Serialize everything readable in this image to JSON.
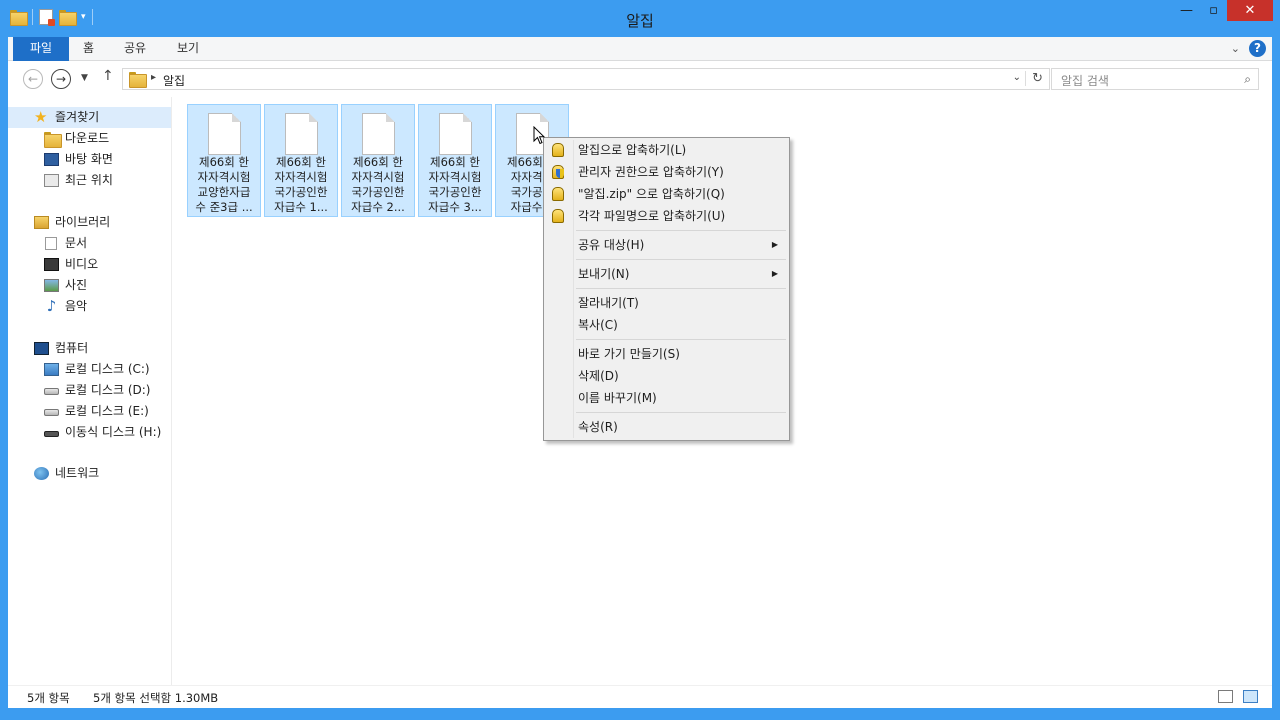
{
  "window": {
    "title": "알집"
  },
  "ribbon": {
    "tabs": [
      "파일",
      "홈",
      "공유",
      "보기"
    ]
  },
  "address": {
    "crumb": "알집"
  },
  "search": {
    "placeholder": "알집 검색"
  },
  "sidebar": {
    "items": [
      {
        "label": "즐겨찾기",
        "icon": "star-icon"
      },
      {
        "label": "다운로드",
        "icon": "download-folder-icon"
      },
      {
        "label": "바탕 화면",
        "icon": "desktop-icon"
      },
      {
        "label": "최근 위치",
        "icon": "recent-places-icon"
      },
      {
        "label": "라이브러리",
        "icon": "library-icon"
      },
      {
        "label": "문서",
        "icon": "documents-icon"
      },
      {
        "label": "비디오",
        "icon": "videos-icon"
      },
      {
        "label": "사진",
        "icon": "pictures-icon"
      },
      {
        "label": "음악",
        "icon": "music-icon"
      },
      {
        "label": "컴퓨터",
        "icon": "computer-icon"
      },
      {
        "label": "로컬 디스크 (C:)",
        "icon": "system-drive-icon"
      },
      {
        "label": "로컬 디스크 (D:)",
        "icon": "drive-icon"
      },
      {
        "label": "로컬 디스크 (E:)",
        "icon": "drive-icon"
      },
      {
        "label": "이동식 디스크 (H:)",
        "icon": "removable-drive-icon"
      },
      {
        "label": "네트워크",
        "icon": "network-icon"
      }
    ]
  },
  "files": [
    {
      "name": "제66회 한\n자자격시험\n교양한자급\n수 준3급 ..."
    },
    {
      "name": "제66회 한\n자자격시험\n국가공인한\n자급수 1..."
    },
    {
      "name": "제66회 한\n자자격시험\n국가공인한\n자급수 2..."
    },
    {
      "name": "제66회 한\n자자격시험\n국가공인한\n자급수 3..."
    },
    {
      "name": "제66회 한\n자자격시\n국가공인\n자급수 4"
    }
  ],
  "context_menu": {
    "items": [
      {
        "label": "알집으로 압축하기(L)"
      },
      {
        "label": "관리자 권한으로 압축하기(Y)"
      },
      {
        "label": "\"알집.zip\" 으로 압축하기(Q)"
      },
      {
        "label": "각각 파일명으로 압축하기(U)"
      },
      {
        "label": "공유 대상(H)"
      },
      {
        "label": "보내기(N)"
      },
      {
        "label": "잘라내기(T)"
      },
      {
        "label": "복사(C)"
      },
      {
        "label": "바로 가기 만들기(S)"
      },
      {
        "label": "삭제(D)"
      },
      {
        "label": "이름 바꾸기(M)"
      },
      {
        "label": "속성(R)"
      }
    ]
  },
  "status": {
    "count": "5개 항목",
    "selection": "5개 항목 선택함 1.30MB"
  },
  "colors": {
    "frame": "#3c9cf0",
    "selection": "#cce8ff",
    "file_tab": "#1e6fc8",
    "close": "#c7312a"
  }
}
